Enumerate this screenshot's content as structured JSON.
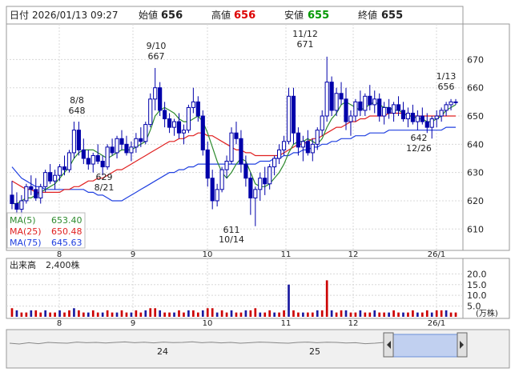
{
  "header": {
    "date_label": "日付",
    "date_value": "2026/01/13 09:27",
    "open_label": "始値",
    "open_value": "656",
    "high_label": "高値",
    "high_value": "656",
    "low_label": "安値",
    "low_value": "655",
    "close_label": "終値",
    "close_value": "655"
  },
  "colors": {
    "up": "#0000aa",
    "down": "#0000aa",
    "ma5": "#2e8b2e",
    "ma25": "#e02020",
    "ma75": "#2040e0",
    "volume": "#cc0000",
    "high_value": "#dd0000",
    "low_value": "#009900"
  },
  "ma_legend": [
    {
      "label": "MA(5)",
      "value": "653.40",
      "color": "#2e8b2e"
    },
    {
      "label": "MA(25)",
      "value": "650.48",
      "color": "#e02020"
    },
    {
      "label": "MA(75)",
      "value": "645.63",
      "color": "#2040e0"
    }
  ],
  "volume_panel": {
    "label": "出来高",
    "value": "2,400株",
    "unit": "(万株)"
  },
  "navigator": {
    "year_labels": [
      "24",
      "25"
    ]
  },
  "chart_data": {
    "type": "candlestick",
    "y_ticks": [
      "610",
      "620",
      "630",
      "640",
      "650",
      "660",
      "670"
    ],
    "ylim": [
      603,
      682
    ],
    "x_ticks": [
      "8",
      "9",
      "10",
      "11",
      "12",
      "26/1"
    ],
    "volume_ticks": [
      "5.0",
      "10.0",
      "15.0",
      "20.0"
    ],
    "volume_ylim": [
      0,
      22
    ],
    "annotations": [
      {
        "date_label": "8/8",
        "value": "648"
      },
      {
        "date_label": "8/21",
        "value": "629"
      },
      {
        "date_label": "9/10",
        "value": "667"
      },
      {
        "date_label": "10/14",
        "value": "611"
      },
      {
        "date_label": "11/12",
        "value": "671"
      },
      {
        "date_label": "12/26",
        "value": "642"
      },
      {
        "date_label": "1/13",
        "value": "656"
      }
    ],
    "candles": [
      [
        622,
        627,
        617,
        619
      ],
      [
        619,
        623,
        615,
        617
      ],
      [
        617,
        622,
        614,
        620
      ],
      [
        620,
        626,
        619,
        625
      ],
      [
        625,
        629,
        622,
        624
      ],
      [
        624,
        628,
        620,
        621
      ],
      [
        621,
        626,
        619,
        625
      ],
      [
        625,
        631,
        623,
        630
      ],
      [
        630,
        633,
        626,
        627
      ],
      [
        627,
        631,
        624,
        629
      ],
      [
        629,
        633,
        627,
        632
      ],
      [
        632,
        636,
        629,
        631
      ],
      [
        631,
        638,
        630,
        637
      ],
      [
        637,
        648,
        635,
        645
      ],
      [
        645,
        648,
        636,
        638
      ],
      [
        638,
        642,
        633,
        635
      ],
      [
        635,
        638,
        631,
        633
      ],
      [
        633,
        637,
        630,
        636
      ],
      [
        636,
        640,
        633,
        634
      ],
      [
        634,
        636,
        629,
        632
      ],
      [
        632,
        640,
        631,
        639
      ],
      [
        639,
        642,
        636,
        637
      ],
      [
        637,
        643,
        635,
        642
      ],
      [
        642,
        645,
        638,
        640
      ],
      [
        640,
        643,
        636,
        637
      ],
      [
        637,
        641,
        634,
        639
      ],
      [
        639,
        644,
        637,
        642
      ],
      [
        642,
        646,
        639,
        641
      ],
      [
        641,
        648,
        640,
        647
      ],
      [
        647,
        658,
        646,
        656
      ],
      [
        656,
        667,
        652,
        660
      ],
      [
        660,
        662,
        650,
        652
      ],
      [
        652,
        655,
        646,
        649
      ],
      [
        649,
        651,
        644,
        646
      ],
      [
        646,
        649,
        643,
        648
      ],
      [
        648,
        651,
        642,
        644
      ],
      [
        644,
        647,
        640,
        645
      ],
      [
        645,
        654,
        644,
        653
      ],
      [
        653,
        660,
        651,
        655
      ],
      [
        655,
        657,
        648,
        650
      ],
      [
        650,
        652,
        636,
        638
      ],
      [
        638,
        641,
        625,
        628
      ],
      [
        628,
        631,
        617,
        620
      ],
      [
        620,
        626,
        618,
        624
      ],
      [
        624,
        632,
        623,
        631
      ],
      [
        631,
        636,
        628,
        634
      ],
      [
        634,
        646,
        633,
        644
      ],
      [
        644,
        648,
        640,
        642
      ],
      [
        642,
        645,
        630,
        633
      ],
      [
        633,
        636,
        625,
        628
      ],
      [
        628,
        630,
        615,
        621
      ],
      [
        621,
        625,
        611,
        624
      ],
      [
        624,
        630,
        620,
        628
      ],
      [
        628,
        632,
        622,
        626
      ],
      [
        626,
        633,
        624,
        632
      ],
      [
        632,
        636,
        629,
        635
      ],
      [
        635,
        640,
        633,
        638
      ],
      [
        638,
        643,
        636,
        641
      ],
      [
        641,
        660,
        640,
        657
      ],
      [
        657,
        660,
        640,
        644
      ],
      [
        644,
        646,
        636,
        639
      ],
      [
        639,
        643,
        634,
        641
      ],
      [
        641,
        645,
        636,
        637
      ],
      [
        637,
        642,
        634,
        640
      ],
      [
        640,
        646,
        638,
        645
      ],
      [
        645,
        652,
        643,
        650
      ],
      [
        650,
        671,
        648,
        662
      ],
      [
        662,
        664,
        650,
        652
      ],
      [
        652,
        660,
        650,
        658
      ],
      [
        658,
        662,
        654,
        656
      ],
      [
        656,
        660,
        645,
        648
      ],
      [
        648,
        652,
        643,
        650
      ],
      [
        650,
        656,
        648,
        655
      ],
      [
        655,
        659,
        650,
        652
      ],
      [
        652,
        658,
        650,
        657
      ],
      [
        657,
        661,
        652,
        654
      ],
      [
        654,
        659,
        651,
        656
      ],
      [
        656,
        658,
        648,
        650
      ],
      [
        650,
        655,
        647,
        653
      ],
      [
        653,
        656,
        649,
        651
      ],
      [
        651,
        655,
        648,
        654
      ],
      [
        654,
        657,
        650,
        652
      ],
      [
        652,
        655,
        648,
        649
      ],
      [
        649,
        653,
        646,
        651
      ],
      [
        651,
        654,
        647,
        648
      ],
      [
        648,
        652,
        645,
        650
      ],
      [
        650,
        653,
        647,
        648
      ],
      [
        648,
        651,
        644,
        646
      ],
      [
        646,
        650,
        642,
        649
      ],
      [
        649,
        652,
        646,
        650
      ],
      [
        650,
        653,
        648,
        652
      ],
      [
        652,
        655,
        650,
        654
      ],
      [
        654,
        656,
        652,
        655
      ],
      [
        655,
        656,
        654,
        655
      ]
    ],
    "ma5": [
      619,
      619,
      620,
      621,
      621,
      622,
      623,
      624,
      625,
      626,
      628,
      630,
      632,
      635,
      637,
      638,
      638,
      638,
      637,
      636,
      635,
      636,
      637,
      638,
      638,
      638,
      639,
      640,
      641,
      645,
      650,
      652,
      653,
      652,
      651,
      649,
      648,
      648,
      649,
      650,
      648,
      644,
      639,
      634,
      630,
      628,
      630,
      633,
      635,
      634,
      630,
      626,
      625,
      625,
      626,
      628,
      630,
      633,
      637,
      640,
      641,
      641,
      642,
      641,
      640,
      642,
      646,
      649,
      651,
      654,
      655,
      654,
      653,
      652,
      653,
      654,
      655,
      654,
      653,
      653,
      652,
      652,
      651,
      650,
      650,
      649,
      649,
      648,
      648,
      649,
      650,
      652,
      653,
      654
    ],
    "ma25": [
      627,
      626,
      625,
      624,
      624,
      623,
      623,
      623,
      623,
      623,
      623,
      624,
      624,
      625,
      625,
      626,
      627,
      627,
      628,
      628,
      629,
      630,
      631,
      631,
      632,
      633,
      634,
      635,
      636,
      637,
      638,
      639,
      640,
      641,
      641,
      642,
      642,
      643,
      643,
      644,
      644,
      643,
      643,
      642,
      641,
      640,
      639,
      638,
      638,
      637,
      637,
      636,
      636,
      636,
      636,
      636,
      636,
      637,
      638,
      639,
      640,
      640,
      641,
      642,
      642,
      643,
      644,
      645,
      646,
      646,
      647,
      648,
      648,
      649,
      649,
      650,
      650,
      650,
      650,
      651,
      651,
      651,
      651,
      650,
      650,
      650,
      650,
      650,
      650,
      650,
      650,
      650,
      650,
      650
    ],
    "ma75": [
      632,
      630,
      628,
      627,
      626,
      625,
      625,
      624,
      624,
      624,
      624,
      624,
      624,
      624,
      624,
      624,
      623,
      623,
      622,
      622,
      621,
      620,
      620,
      620,
      621,
      622,
      623,
      624,
      625,
      626,
      627,
      628,
      629,
      630,
      630,
      631,
      631,
      632,
      632,
      633,
      633,
      633,
      633,
      633,
      633,
      633,
      633,
      633,
      633,
      633,
      633,
      633,
      634,
      634,
      634,
      635,
      635,
      636,
      636,
      637,
      637,
      638,
      638,
      639,
      639,
      640,
      640,
      641,
      641,
      642,
      642,
      642,
      643,
      643,
      643,
      644,
      644,
      644,
      644,
      645,
      645,
      645,
      645,
      645,
      645,
      645,
      645,
      645,
      645,
      645,
      645,
      646,
      646,
      646
    ],
    "volume": [
      4,
      3,
      2,
      2,
      3,
      3,
      2,
      3,
      2,
      2,
      3,
      2,
      3,
      4,
      3,
      2,
      2,
      3,
      2,
      2,
      3,
      2,
      2,
      3,
      2,
      2,
      3,
      2,
      3,
      4,
      4,
      3,
      2,
      2,
      2,
      3,
      2,
      3,
      3,
      2,
      3,
      4,
      4,
      2,
      3,
      2,
      3,
      2,
      2,
      3,
      3,
      4,
      2,
      2,
      3,
      2,
      2,
      3,
      15,
      3,
      2,
      2,
      2,
      2,
      3,
      3,
      17,
      3,
      2,
      3,
      3,
      2,
      2,
      3,
      2,
      2,
      3,
      2,
      2,
      2,
      3,
      2,
      2,
      2,
      3,
      2,
      2,
      3,
      2,
      3,
      3,
      3,
      2,
      2
    ],
    "navigator_series": [
      0.55,
      0.5,
      0.58,
      0.52,
      0.6,
      0.57,
      0.55,
      0.62,
      0.58,
      0.6,
      0.56,
      0.6,
      0.63,
      0.58,
      0.61,
      0.57,
      0.62,
      0.59,
      0.6,
      0.64,
      0.58,
      0.61,
      0.57,
      0.6,
      0.55,
      0.58,
      0.62,
      0.6,
      0.57,
      0.55,
      0.6,
      0.62,
      0.58,
      0.61,
      0.6,
      0.56,
      0.58,
      0.52,
      0.55,
      0.6
    ]
  }
}
